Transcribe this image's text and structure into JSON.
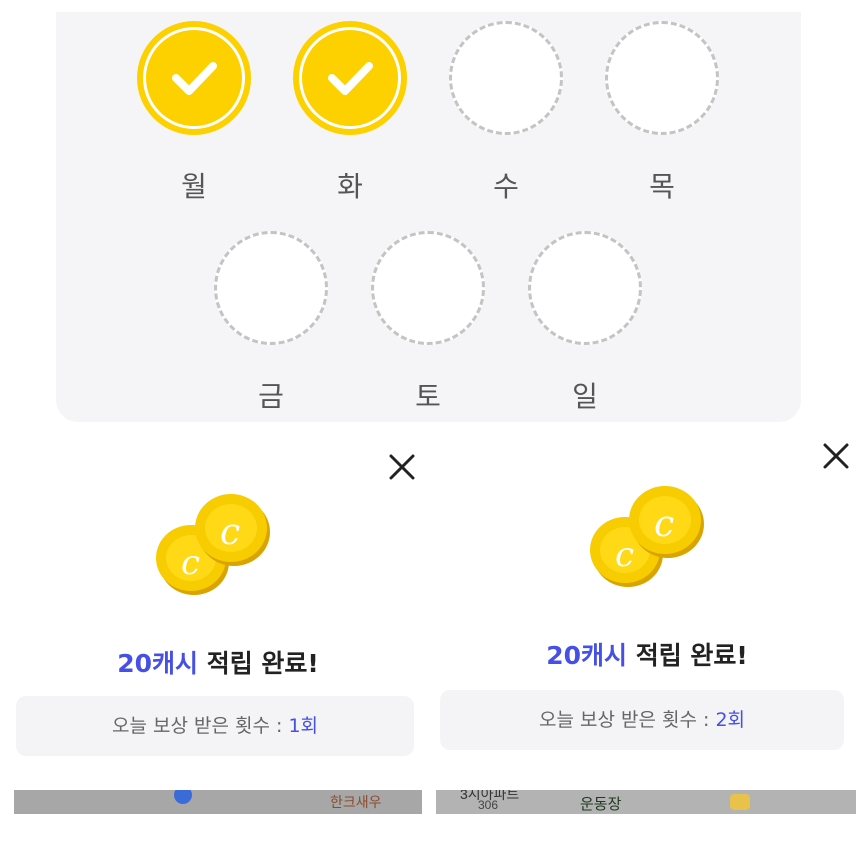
{
  "attendance": {
    "days": [
      {
        "label": "월",
        "checked": true
      },
      {
        "label": "화",
        "checked": true
      },
      {
        "label": "수",
        "checked": false
      },
      {
        "label": "목",
        "checked": false
      },
      {
        "label": "금",
        "checked": false
      },
      {
        "label": "토",
        "checked": false
      },
      {
        "label": "일",
        "checked": false
      }
    ]
  },
  "popups": [
    {
      "title_accent": "20캐시",
      "title_rest": " 적립 완료!",
      "count_label": "오늘 보상 받은 횟수 : ",
      "count_value": "1회"
    },
    {
      "title_accent": "20캐시",
      "title_rest": " 적립 완료!",
      "count_label": "오늘 보상 받은 횟수 : ",
      "count_value": "2회"
    }
  ],
  "maps": [
    {
      "label": "한크새우"
    },
    {
      "label_a": "3시아파트",
      "label_b": "306",
      "label_c": "운동장"
    }
  ],
  "colors": {
    "accent": "#4650e6",
    "coin": "#fdd000",
    "panel": "#f5f5f7"
  },
  "icons": {
    "check": "check-icon",
    "close": "close-icon",
    "coins": "coins-icon"
  }
}
